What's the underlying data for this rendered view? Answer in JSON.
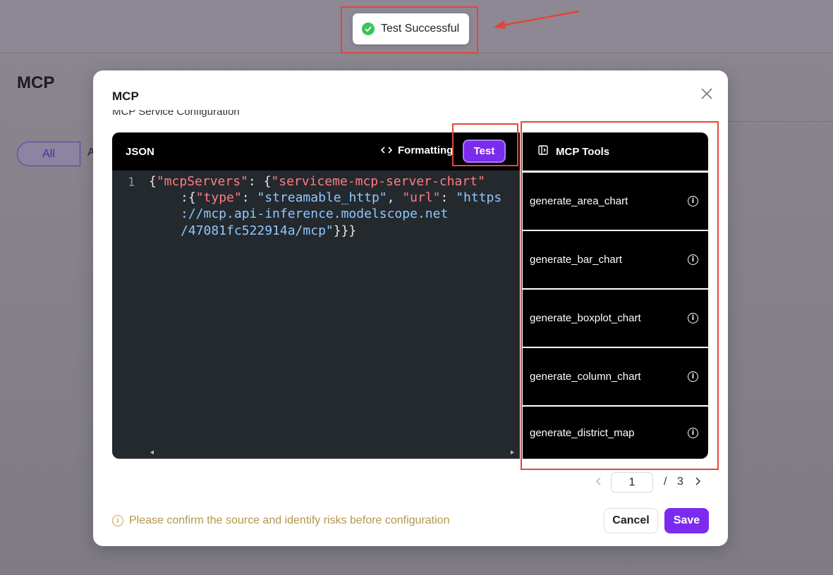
{
  "background": {
    "page_title": "MCP",
    "filter_all": "All",
    "filter_next": "A"
  },
  "toast": {
    "message": "Test Successful",
    "icon": "check-circle-icon",
    "color": "#3cc35c"
  },
  "modal": {
    "title": "MCP",
    "section_label": "MCP Service Configuration",
    "editor": {
      "label": "JSON",
      "format_label": "Formatting",
      "test_label": "Test",
      "line_number": "1",
      "code": {
        "t1": "{",
        "t2": "\"mcpServers\"",
        "t3": ": {",
        "t4": "\"serviceme-mcp-server-chart\"",
        "t5": ":{",
        "t6": "\"type\"",
        "t7": ": ",
        "t8": "\"streamable_http\"",
        "t9": ", ",
        "t10": "\"url\"",
        "t11": ": ",
        "t12": "\"https",
        "t13": "://mcp.api-inference.modelscope.net",
        "t14": "/47081fc522914a/mcp\"",
        "t15": "}}}"
      }
    },
    "tools": {
      "header": "MCP Tools",
      "items": [
        "generate_area_chart",
        "generate_bar_chart",
        "generate_boxplot_chart",
        "generate_column_chart",
        "generate_district_map"
      ]
    },
    "pagination": {
      "current": "1",
      "separator": "/",
      "total": "3"
    },
    "warning": "Please confirm the source and identify risks before configuration",
    "cancel_label": "Cancel",
    "save_label": "Save"
  },
  "colors": {
    "accent": "#7b2bf0",
    "annotation": "#e0473a",
    "warning": "#b3964a"
  }
}
